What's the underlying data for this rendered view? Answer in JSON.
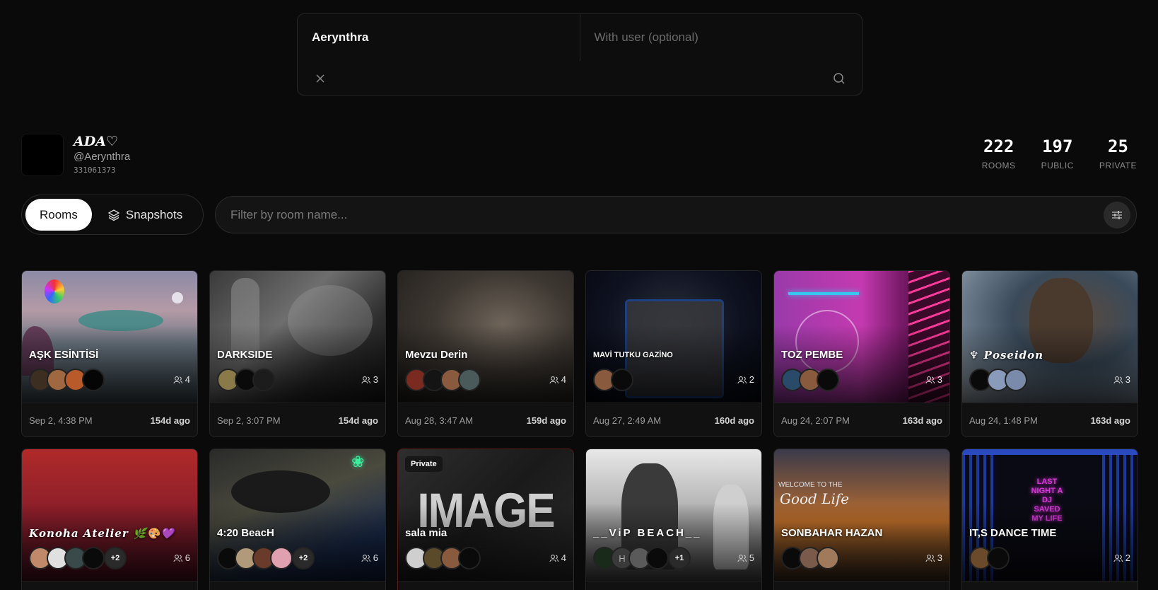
{
  "search": {
    "user_value": "Aerynthra",
    "with_user_placeholder": "With user (optional)",
    "clear_icon": "close-icon",
    "search_icon": "search-icon"
  },
  "profile": {
    "display_name": "ADA♡",
    "handle": "@Aerynthra",
    "id": "331061373"
  },
  "stats": [
    {
      "value": "222",
      "label": "ROOMS"
    },
    {
      "value": "197",
      "label": "PUBLIC"
    },
    {
      "value": "25",
      "label": "PRIVATE"
    }
  ],
  "tabs": {
    "rooms": "Rooms",
    "snapshots": "Snapshots",
    "active": "rooms"
  },
  "filter": {
    "placeholder": "Filter by room name...",
    "settings_icon": "sliders-icon"
  },
  "rooms": [
    {
      "title": "AŞK ESİNTİSİ",
      "users": "4",
      "date": "Sep 2, 4:38 PM",
      "ago": "154d ago",
      "avatars": 4,
      "more": ""
    },
    {
      "title": "DARKSIDE",
      "users": "3",
      "date": "Sep 2, 3:07 PM",
      "ago": "154d ago",
      "avatars": 3,
      "more": ""
    },
    {
      "title": "Mevzu Derin",
      "users": "4",
      "date": "Aug 28, 3:47 AM",
      "ago": "159d ago",
      "avatars": 4,
      "more": ""
    },
    {
      "title": "MAVİ TUTKU GAZİNO",
      "users": "2",
      "date": "Aug 27, 2:49 AM",
      "ago": "160d ago",
      "avatars": 2,
      "more": ""
    },
    {
      "title": "TOZ PEMBE",
      "users": "3",
      "date": "Aug 24, 2:07 PM",
      "ago": "163d ago",
      "avatars": 3,
      "more": ""
    },
    {
      "title": "♆ 𝑷𝒐𝒔𝒆𝒊𝒅𝒐𝒏",
      "users": "3",
      "date": "Aug 24, 1:48 PM",
      "ago": "163d ago",
      "avatars": 3,
      "more": ""
    },
    {
      "title": "𝑲𝒐𝒏𝒐𝒉𝒂 𝑨𝒕𝒆𝒍𝒊𝒆𝒓 🌿🎨💜",
      "users": "6",
      "avatars": 4,
      "more": "+2"
    },
    {
      "title": "4:20 BeacH",
      "users": "6",
      "avatars": 4,
      "more": "+2"
    },
    {
      "title": "sala mia",
      "users": "4",
      "avatars": 4,
      "more": "",
      "badge": "Private",
      "image_word": "IMAGE"
    },
    {
      "title": "__ViP BEACH__",
      "users": "5",
      "avatars": 4,
      "more": "+1"
    },
    {
      "title": "SONBAHAR HAZAN",
      "users": "3",
      "avatars": 3,
      "more": "",
      "overlay_small": "WELCOME TO THE",
      "overlay_script": "Good Life"
    },
    {
      "title": "IT,S DANCE TIME",
      "users": "2",
      "avatars": 2,
      "more": "",
      "neon": "LAST NIGHT A DJ SAVED MY LIFE"
    }
  ],
  "colors": {
    "background": "#0a0a0a",
    "card": "#111111",
    "accent_active_tab": "#ffffff"
  }
}
